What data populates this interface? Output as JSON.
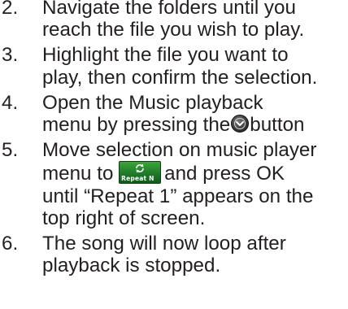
{
  "steps": [
    {
      "number": "2.",
      "lines": [
        "Navigate the folders until you",
        "reach the file you wish to play."
      ]
    },
    {
      "number": "3.",
      "lines": [
        "Highlight the file you want to",
        "play, then confirm the selection."
      ]
    },
    {
      "number": "4.",
      "line1": "Open the Music playback",
      "line2_before": "menu by pressing the",
      "line2_after": "button",
      "icon": "menu-button-icon"
    },
    {
      "number": "5.",
      "line1": "Move selection on music player",
      "line2_before": "menu to",
      "line2_after": "and press OK",
      "line3": "until “Repeat 1” appears on the",
      "line4": "top right of screen.",
      "icon": "repeat-mode-icon",
      "icon_text": "Repeat N"
    },
    {
      "number": "6.",
      "lines": [
        "The song will now loop after",
        "playback is stopped."
      ]
    }
  ]
}
